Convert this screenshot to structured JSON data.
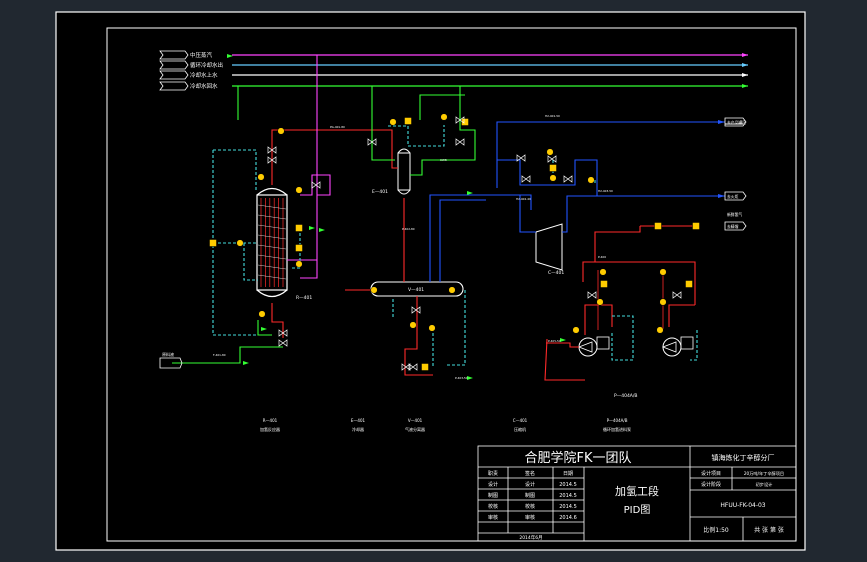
{
  "legend_lines": [
    {
      "label": "中压蒸汽",
      "color": "#ff44ff"
    },
    {
      "label": "循环冷却水出",
      "color": "#66ccff"
    },
    {
      "label": "冷却水上水",
      "color": "#ffffff"
    },
    {
      "label": "冷却水回水",
      "color": "#33ff33"
    }
  ],
  "equipment_tags": [
    "R—401",
    "E—401",
    "V—401",
    "C—401",
    "P—404A/B"
  ],
  "stream_tags": [
    "去产品罐区",
    "去火炬",
    "去精馏",
    "新鲜氢气",
    "原料液"
  ],
  "bottom_captions": [
    {
      "tag": "R—401",
      "name": "加氢反应器"
    },
    {
      "tag": "E—401",
      "name": "冷却器"
    },
    {
      "tag": "V—401",
      "name": "气液分离器"
    },
    {
      "tag": "C—401",
      "name": "压缩机"
    },
    {
      "tag": "P—404A/B",
      "name": "循环加氢进料泵"
    }
  ],
  "title_block": {
    "team": "合肥学院FK一团队",
    "company": "镇海炼化丁辛醇分厂",
    "section": "加氢工段",
    "drawing_type": "PID图",
    "rows": [
      {
        "role": "职责",
        "name": "签名",
        "date": "日期"
      },
      {
        "role": "设计",
        "name": "设计",
        "date": "2014.5"
      },
      {
        "role": "制图",
        "name": "制图",
        "date": "2014.5"
      },
      {
        "role": "校核",
        "name": "校核",
        "date": "2014.5"
      },
      {
        "role": "审核",
        "name": "审核",
        "date": "2014.6"
      }
    ],
    "right_info": [
      {
        "k": "设计项目",
        "v": "20万吨/年丁辛醇项目"
      },
      {
        "k": "设计阶段",
        "v": "初步设计"
      }
    ],
    "drawing_no": "HFUU-FK-04-03",
    "scale": "比例1:50",
    "sheets": "共 张 第 张",
    "date_note": "2014年6月"
  }
}
